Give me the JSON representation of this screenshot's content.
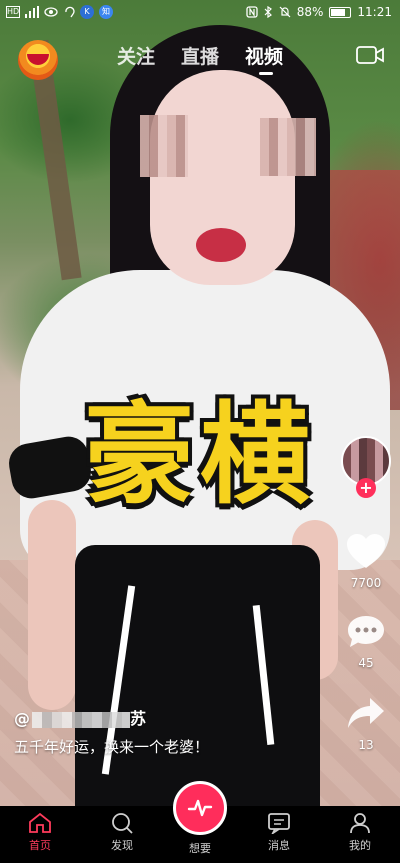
{
  "status_bar": {
    "battery": "88%",
    "battery_level": 0.88,
    "time": "11:21",
    "left_icons": [
      "hd-icon",
      "signal-icon",
      "eye-icon",
      "ear-icon",
      "k-badge-icon",
      "nfc-badge-icon"
    ],
    "right_icons": [
      "nfc-icon",
      "bluetooth-icon",
      "mute-icon",
      "battery-icon"
    ]
  },
  "top_nav": {
    "tabs": [
      {
        "label": "关注"
      },
      {
        "label": "直播"
      },
      {
        "label": "视频"
      }
    ],
    "active_tab": "视频"
  },
  "video": {
    "caption_overlay": "豪横"
  },
  "actions": {
    "likes": "7700",
    "comments": "45",
    "shares": "13"
  },
  "post": {
    "author_prefix": "@",
    "author_suffix": "苏",
    "description": "五千年好运，换来一个老婆！"
  },
  "bottom_nav": {
    "items": [
      {
        "label": "首页"
      },
      {
        "label": "发现"
      },
      {
        "label": "想要"
      },
      {
        "label": "消息"
      },
      {
        "label": "我的"
      }
    ],
    "active": "首页"
  },
  "colors": {
    "accent": "#ff2d5b",
    "caption_yellow": "#f6d21e"
  }
}
